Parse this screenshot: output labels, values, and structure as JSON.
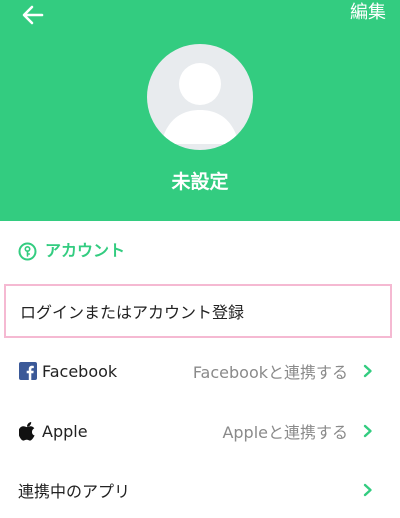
{
  "header": {
    "edit_label": "編集",
    "profile_name": "未設定",
    "background_color": "#33cc80"
  },
  "account_section": {
    "title": "アカウント",
    "login_label": "ログインまたはアカウント登録",
    "rows": [
      {
        "label": "Facebook",
        "status": "Facebookと連携する",
        "icon": "facebook-icon"
      },
      {
        "label": "Apple",
        "status": "Appleと連携する",
        "icon": "apple-icon"
      },
      {
        "label": "連携中のアプリ",
        "status": "",
        "icon": ""
      }
    ]
  },
  "colors": {
    "accent": "#33cc80",
    "highlight_border": "#f5b9d2",
    "facebook": "#3b5998"
  }
}
